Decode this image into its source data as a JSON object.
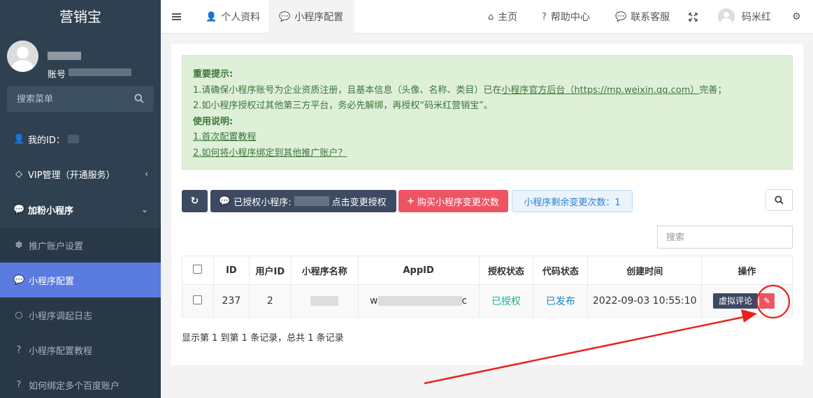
{
  "sidebar": {
    "brand": "营销宝",
    "account_label": "账号",
    "search_placeholder": "搜索菜单",
    "my_id_label": "我的ID：",
    "items": [
      {
        "label": "VIP管理（开通服务）"
      },
      {
        "label": "加粉小程序"
      }
    ],
    "sub_items": [
      {
        "label": "推广账户设置"
      },
      {
        "label": "小程序配置"
      },
      {
        "label": "小程序调起日志"
      },
      {
        "label": "小程序配置教程"
      },
      {
        "label": "如何绑定多个百度账户"
      }
    ]
  },
  "topbar": {
    "tab_profile": "个人资料",
    "tab_miniapp": "小程序配置",
    "home": "主页",
    "help": "帮助中心",
    "support": "联系客服",
    "user": "码米红"
  },
  "notice": {
    "title1": "重要提示:",
    "line1_a": "1.请确保小程序账号为企业资质注册，且基本信息（头像、名称、类目）已在",
    "line1_link": "小程序官方后台（https://mp.weixin.qq.com）",
    "line1_b": "完善；",
    "line2": "2.如小程序授权过其他第三方平台，务必先解绑，再授权“码米红营销宝”。",
    "title2": "使用说明:",
    "link1": "1.首次配置教程",
    "link2": "2.如何将小程序绑定到其他推广账户？"
  },
  "toolbar": {
    "authorized_label": "已授权小程序:",
    "change_auth": "点击变更授权",
    "buy_label": "购买小程序变更次数",
    "remaining_label": "小程序剩余变更次数：1",
    "table_search_placeholder": "搜索"
  },
  "table": {
    "headers": [
      "ID",
      "用户ID",
      "小程序名称",
      "AppID",
      "授权状态",
      "代码状态",
      "创建时间",
      "操作"
    ],
    "row": {
      "id": "237",
      "user_id": "2",
      "appid_start": "w",
      "appid_end": "c",
      "auth_status": "已授权",
      "code_status": "已发布",
      "created": "2022-09-03 10:55:10",
      "virtual_btn": "虚拟评论"
    }
  },
  "summary": "显示第 1 到第 1 条记录，总共 1 条记录",
  "colors": {
    "sidebar": "#2f4050",
    "active": "#5a7be0",
    "danger": "#ed5565",
    "annotation": "#e8231b"
  },
  "icons": {
    "menu": "hamburger-icon",
    "user": "user-icon",
    "wechat": "wechat-icon",
    "home": "home-icon",
    "help": "question-circle-icon",
    "chat": "comment-icon",
    "fullscreen": "expand-icon",
    "settings": "cogs-icon",
    "refresh": "refresh-icon",
    "plus": "plus-icon",
    "search": "search-icon",
    "pencil": "pencil-icon"
  }
}
